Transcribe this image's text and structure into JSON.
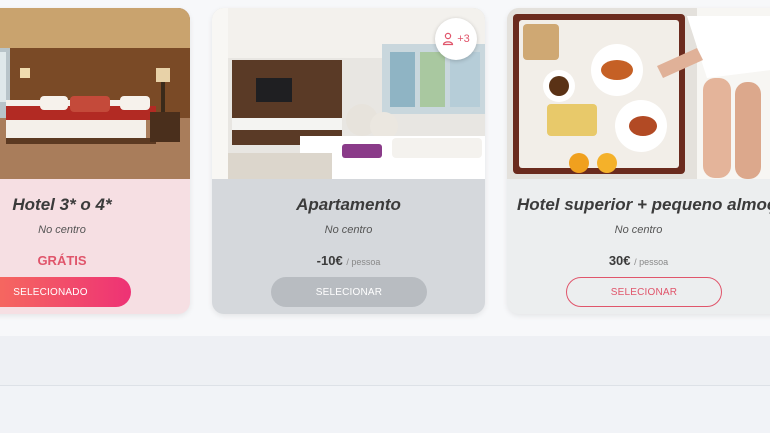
{
  "cards": [
    {
      "title": "Hotel 3* o 4*",
      "location": "No centro",
      "price": "GRÁTIS",
      "price_unit": "",
      "button_label": "SELECIONADO",
      "state": "selected"
    },
    {
      "title": "Apartamento",
      "location": "No centro",
      "price": "-10€",
      "price_unit": "/ pessoa",
      "button_label": "SELECIONAR",
      "state": "disabled",
      "extra_photos": "+3"
    },
    {
      "title": "Hotel superior + pequeno almoço",
      "location": "No centro",
      "price": "30€",
      "price_unit": "/ pessoa",
      "button_label": "SELECIONAR",
      "state": "available"
    }
  ],
  "colors": {
    "accent": "#e0556b",
    "gradient_start": "#f7735b",
    "gradient_end": "#ee3275",
    "disabled_button": "#b8bcc1"
  },
  "icons": {
    "photos_badge": "user-plus-icon"
  }
}
